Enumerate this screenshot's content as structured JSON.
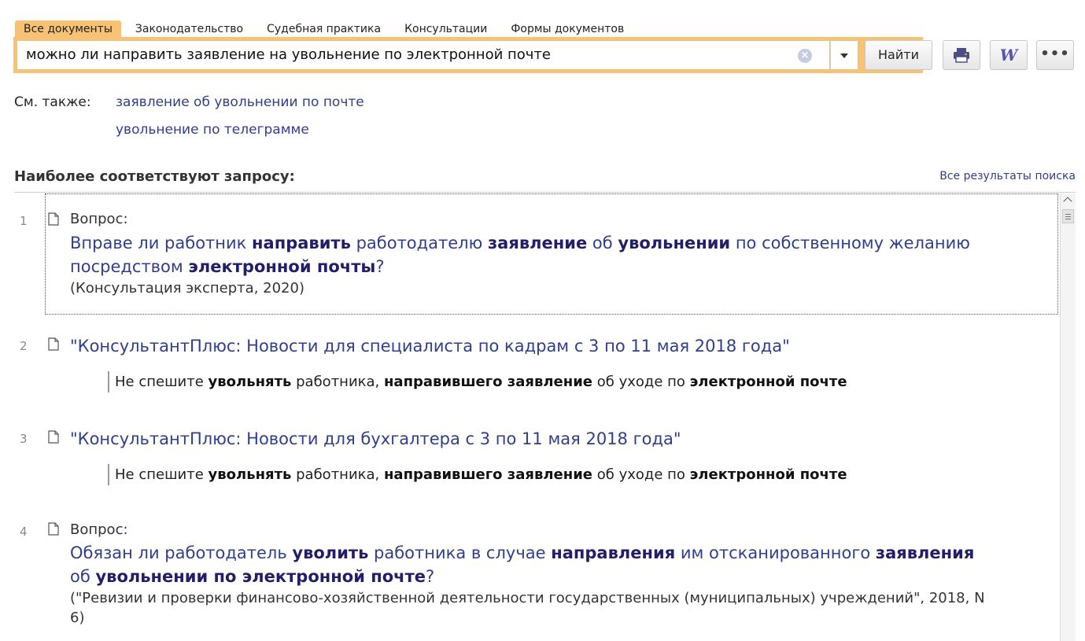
{
  "tabs": [
    {
      "label": "Все документы",
      "active": true
    },
    {
      "label": "Законодательство",
      "active": false
    },
    {
      "label": "Судебная практика",
      "active": false
    },
    {
      "label": "Консультации",
      "active": false
    },
    {
      "label": "Формы документов",
      "active": false
    }
  ],
  "search": {
    "query": "можно ли направить заявление на увольнение по электронной почте",
    "find_label": "Найти",
    "clear_icon": "clear-icon",
    "dropdown_icon": "chevron-down-icon"
  },
  "tools": {
    "print_icon": "printer-icon",
    "word_glyph": "W",
    "more_glyph": "•••"
  },
  "see_also": {
    "label": "См. также:",
    "links": [
      "заявление об увольнении по почте",
      "увольнение по телеграмме"
    ]
  },
  "results_header": {
    "title": "Наиболее соответствуют запросу:",
    "all_results": "Все результаты поиска"
  },
  "results": [
    {
      "num": "1",
      "pre": "Вопрос:",
      "title_parts": [
        {
          "t": "Вправе ли работник ",
          "b": false
        },
        {
          "t": "направить",
          "b": true
        },
        {
          "t": " работодателю ",
          "b": false
        },
        {
          "t": "заявление",
          "b": true
        },
        {
          "t": " об ",
          "b": false
        },
        {
          "t": "увольнении",
          "b": true
        },
        {
          "t": " по собственному желанию посредством ",
          "b": false
        },
        {
          "t": "электронной почты",
          "b": true
        },
        {
          "t": "?",
          "b": false
        }
      ],
      "source": "(Консультация эксперта, 2020)"
    },
    {
      "num": "2",
      "title_parts": [
        {
          "t": "\"КонсультантПлюс: Новости для специалиста по кадрам с 3 по 11 мая 2018 года\"",
          "b": false
        }
      ],
      "snippet_parts": [
        {
          "t": "Не спешите ",
          "b": false
        },
        {
          "t": "увольнять",
          "b": true
        },
        {
          "t": " работника, ",
          "b": false
        },
        {
          "t": "направившего заявление",
          "b": true
        },
        {
          "t": " об уходе по ",
          "b": false
        },
        {
          "t": "электронной почте",
          "b": true
        }
      ]
    },
    {
      "num": "3",
      "title_parts": [
        {
          "t": "\"КонсультантПлюс: Новости для бухгалтера с 3 по 11 мая 2018 года\"",
          "b": false
        }
      ],
      "snippet_parts": [
        {
          "t": "Не спешите ",
          "b": false
        },
        {
          "t": "увольнять",
          "b": true
        },
        {
          "t": " работника, ",
          "b": false
        },
        {
          "t": "направившего заявление",
          "b": true
        },
        {
          "t": " об уходе по ",
          "b": false
        },
        {
          "t": "электронной почте",
          "b": true
        }
      ]
    },
    {
      "num": "4",
      "pre": "Вопрос:",
      "title_parts": [
        {
          "t": "Обязан ли работодатель ",
          "b": false
        },
        {
          "t": "уволить",
          "b": true
        },
        {
          "t": " работника в случае ",
          "b": false
        },
        {
          "t": "направления",
          "b": true
        },
        {
          "t": " им отсканированного ",
          "b": false
        },
        {
          "t": "заявления",
          "b": true
        },
        {
          "t": " об ",
          "b": false
        },
        {
          "t": "увольнении по электронной почте",
          "b": true
        },
        {
          "t": "?",
          "b": false
        }
      ],
      "source": "(\"Ревизии и проверки финансово-хозяйственной деятельности государственных (муниципальных) учреждений\", 2018, N 6)"
    }
  ],
  "colors": {
    "accent": "#f8c274",
    "link": "#2f3e8f",
    "link_bold": "#221e6a",
    "word_icon": "#5753b0",
    "print_icon": "#4a4f8a"
  }
}
